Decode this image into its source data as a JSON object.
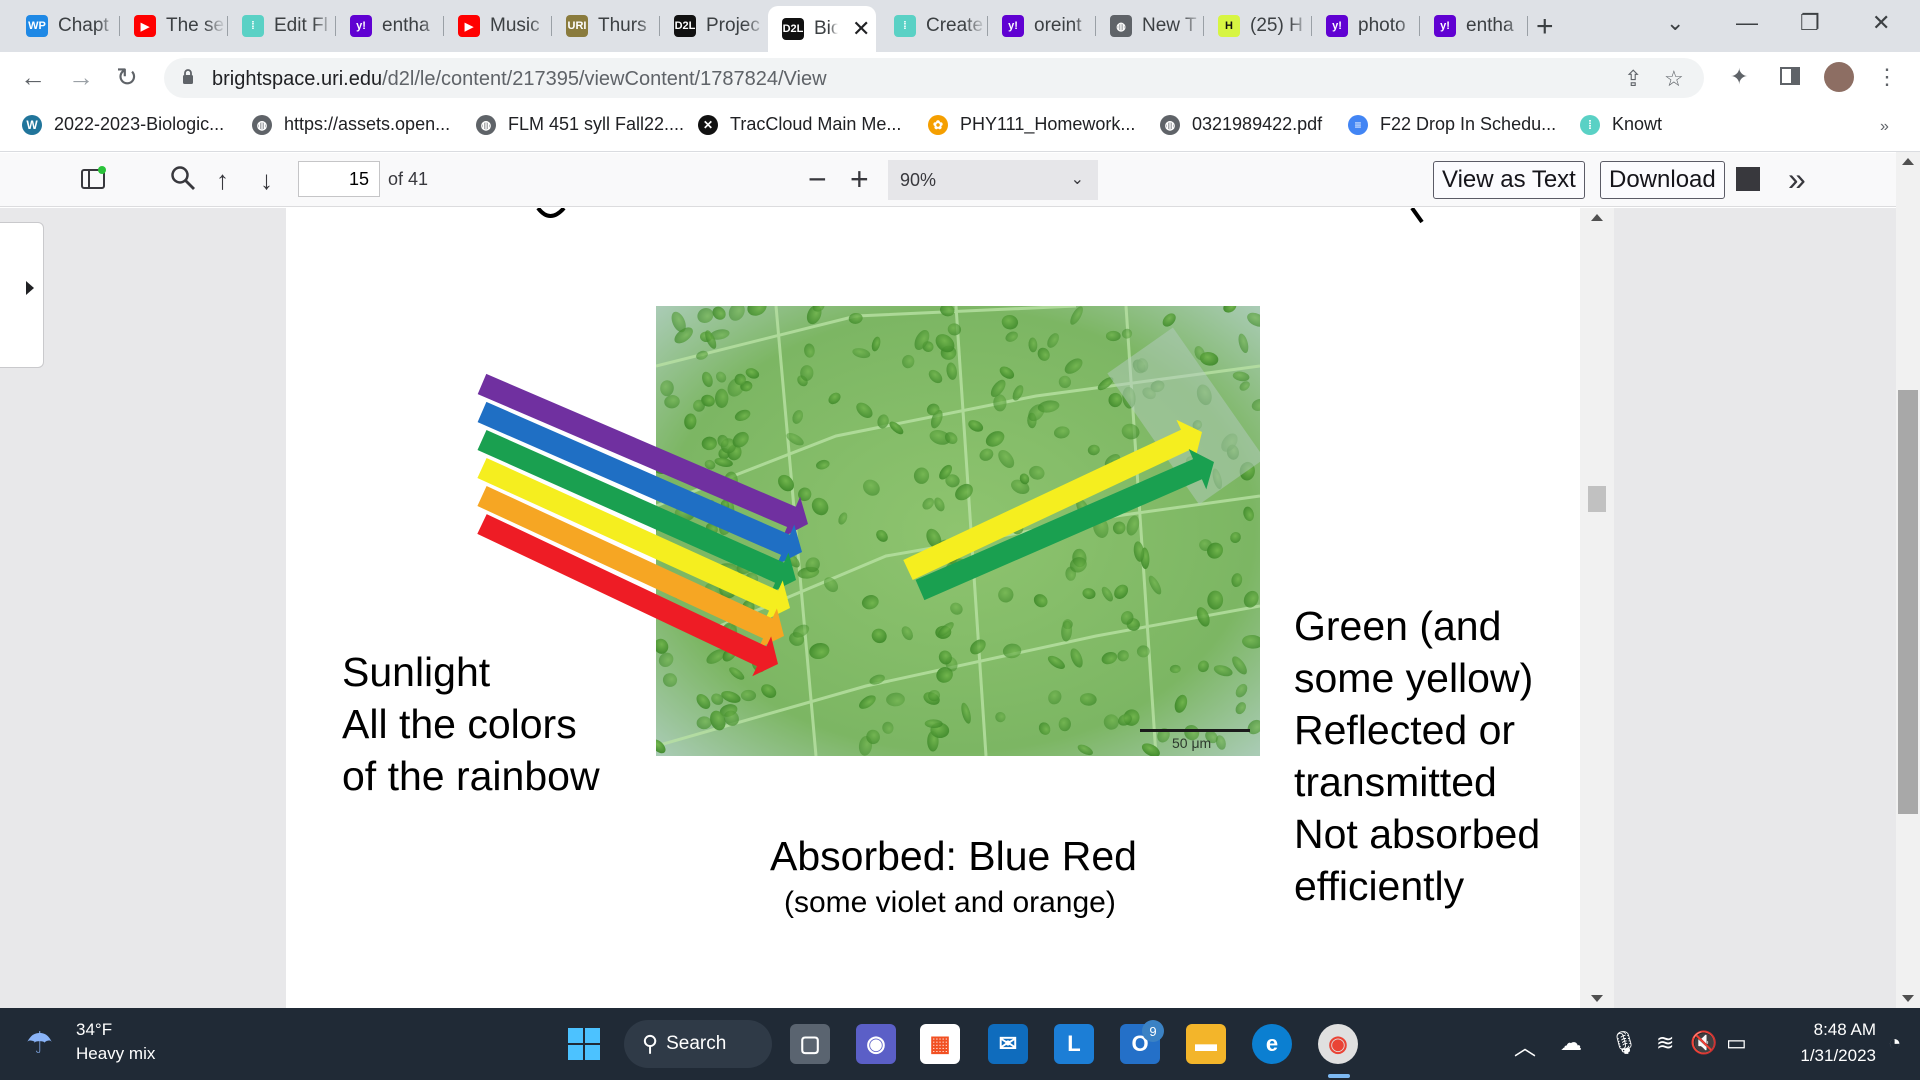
{
  "tabs": [
    {
      "label": "Chapt",
      "icon": "wp-icon",
      "color": "#1e88e5",
      "glyph": "WP"
    },
    {
      "label": "The se",
      "icon": "youtube-icon",
      "color": "#ff0000",
      "glyph": "▶"
    },
    {
      "label": "Edit Fl",
      "icon": "dots-icon",
      "color": "#5ad1c5",
      "glyph": "⁞"
    },
    {
      "label": "entha",
      "icon": "yahoo-icon",
      "color": "#6001d2",
      "glyph": "y!"
    },
    {
      "label": "Music",
      "icon": "youtube-icon",
      "color": "#ff0000",
      "glyph": "▶"
    },
    {
      "label": "Thurs",
      "icon": "uri-icon",
      "color": "#8a7b3d",
      "glyph": "URI"
    },
    {
      "label": "Projec",
      "icon": "d2l-icon",
      "color": "#111111",
      "glyph": "D2L"
    },
    {
      "label": "Bio",
      "icon": "d2l-icon",
      "color": "#111111",
      "glyph": "D2L"
    },
    {
      "label": "Create",
      "icon": "dots-icon",
      "color": "#5ad1c5",
      "glyph": "⁞"
    },
    {
      "label": "oreint",
      "icon": "yahoo-icon",
      "color": "#6001d2",
      "glyph": "y!"
    },
    {
      "label": "New T",
      "icon": "globe-icon",
      "color": "#5f6368",
      "glyph": "◍"
    },
    {
      "label": "(25) H",
      "icon": "h-icon",
      "color": "#d7f542",
      "glyph": "H"
    },
    {
      "label": "photo",
      "icon": "yahoo-icon",
      "color": "#6001d2",
      "glyph": "y!"
    },
    {
      "label": "entha",
      "icon": "yahoo-icon",
      "color": "#6001d2",
      "glyph": "y!"
    }
  ],
  "address": {
    "host": "brightspace.uri.edu",
    "path": "/d2l/le/content/217395/viewContent/1787824/View"
  },
  "bookmarks": [
    {
      "label": "2022-2023-Biologic...",
      "icon": "wordpress-icon",
      "color": "#21759b",
      "glyph": "W"
    },
    {
      "label": "https://assets.open...",
      "icon": "globe-icon",
      "color": "#5f6368",
      "glyph": "◍"
    },
    {
      "label": "FLM 451 syll Fall22....",
      "icon": "globe-icon",
      "color": "#5f6368",
      "glyph": "◍"
    },
    {
      "label": "TracCloud Main Me...",
      "icon": "traccloud-icon",
      "color": "#111111",
      "glyph": "✕"
    },
    {
      "label": "PHY111_Homework...",
      "icon": "homework-icon",
      "color": "#f59f00",
      "glyph": "✿"
    },
    {
      "label": "0321989422.pdf",
      "icon": "globe-icon",
      "color": "#5f6368",
      "glyph": "◍"
    },
    {
      "label": "F22 Drop In Schedu...",
      "icon": "docs-icon",
      "color": "#4285f4",
      "glyph": "≡"
    },
    {
      "label": "Knowt",
      "icon": "dots-icon",
      "color": "#5ad1c5",
      "glyph": "⁞"
    }
  ],
  "pdf": {
    "page_number": "15",
    "page_count": "of 41",
    "zoom": "90%",
    "view_as_text": "View as Text",
    "download": "Download"
  },
  "slide": {
    "sunlight_lines": [
      "Sunlight",
      "All the colors",
      "of the rainbow"
    ],
    "reflected_lines": [
      "Green (and",
      "some yellow)",
      "Reflected or",
      "transmitted",
      "Not absorbed",
      "efficiently"
    ],
    "absorbed": "Absorbed: Blue Red",
    "absorbed_sub": "(some violet and orange)",
    "scale_label": "50 μm",
    "incoming_colors": [
      "#7030a0",
      "#1f6fc4",
      "#1aa050",
      "#f5ee1f",
      "#f6a623",
      "#ee1c25"
    ],
    "outgoing_colors": [
      "#f5ee1f",
      "#1aa050"
    ]
  },
  "taskbar": {
    "temperature": "34°F",
    "weather": "Heavy mix",
    "search": "Search",
    "time": "8:48 AM",
    "date": "1/31/2023",
    "mail_badge": "9"
  }
}
